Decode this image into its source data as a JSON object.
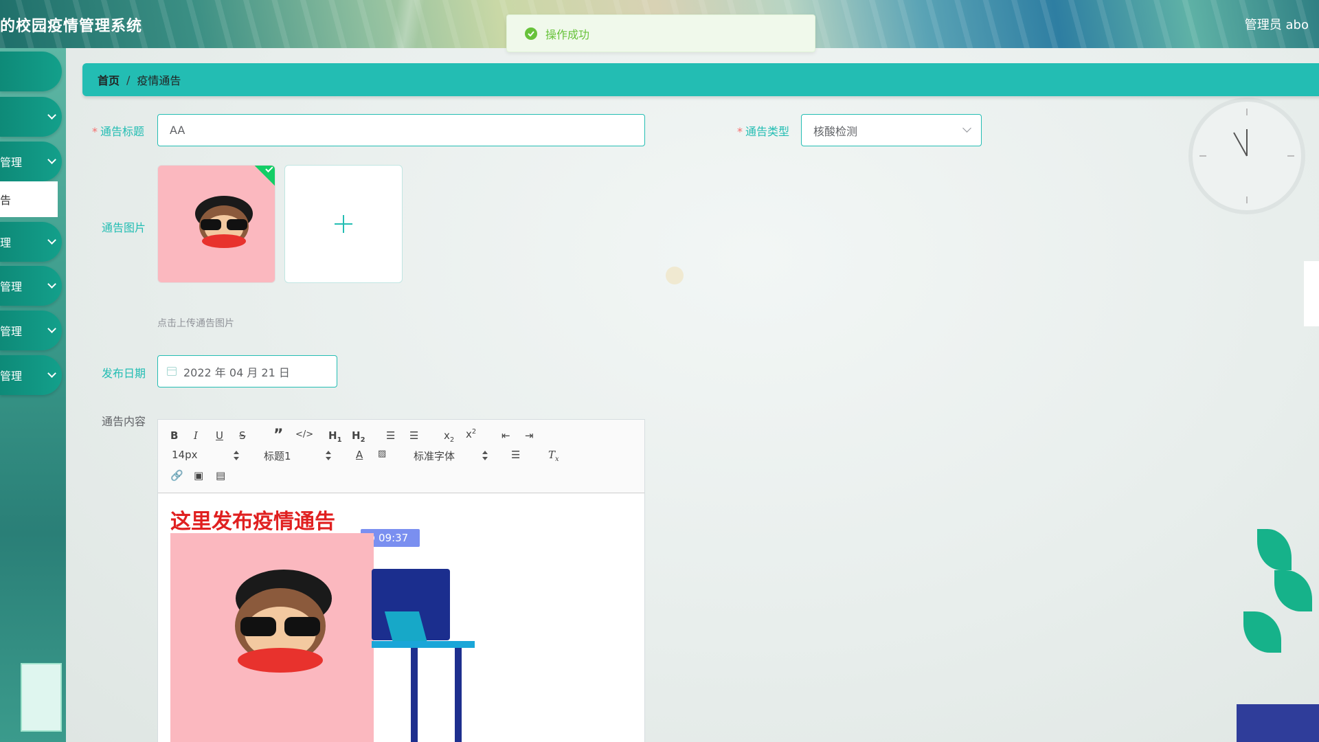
{
  "header": {
    "app_title": "的校园疫情管理系统",
    "user_label": "管理员 abo"
  },
  "toast": {
    "message": "操作成功"
  },
  "sidebar": {
    "items": [
      {
        "label": ""
      },
      {
        "label": ""
      },
      {
        "label": "管理"
      },
      {
        "label": "告"
      },
      {
        "label": "理"
      },
      {
        "label": "管理"
      },
      {
        "label": "管理"
      },
      {
        "label": "管理"
      }
    ]
  },
  "breadcrumb": {
    "home": "首页",
    "separator": "/",
    "current": "疫情通告"
  },
  "form": {
    "title_label": "通告标题",
    "title_value": "AA",
    "type_label": "通告类型",
    "type_value": "核酸检测",
    "image_label": "通告图片",
    "upload_tip": "点击上传通告图片",
    "date_label": "发布日期",
    "date_value": "2022 年 04 月 21 日",
    "content_label": "通告内容"
  },
  "editor": {
    "font_size": "14px",
    "heading": "标题1",
    "font_family": "标准字体",
    "content_heading": "这里发布疫情通告",
    "time_badge": "09:37"
  },
  "colors": {
    "accent": "#23bdb3",
    "success": "#67c23a",
    "required": "#f56c6c",
    "content_heading": "#e02020"
  }
}
